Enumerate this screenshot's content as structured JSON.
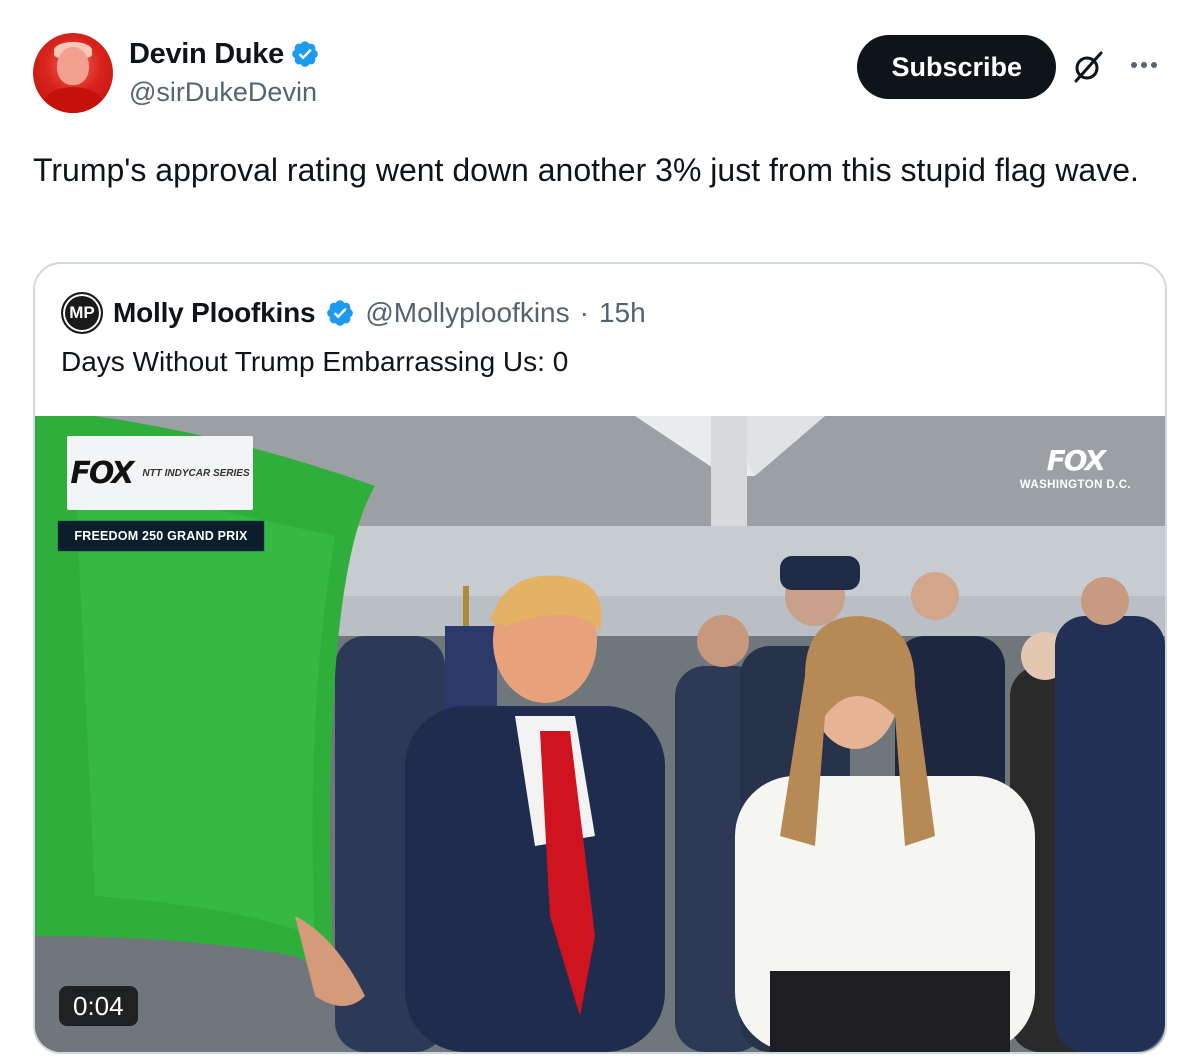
{
  "author": {
    "display_name": "Devin Duke",
    "handle": "@sirDukeDevin",
    "verified_icon": "verified-badge-icon"
  },
  "actions": {
    "subscribe_label": "Subscribe",
    "grok_icon": "grok-icon",
    "more_icon": "more-icon"
  },
  "tweet": {
    "text": "Trump's approval rating went down another 3% just from this stupid flag wave."
  },
  "quoted": {
    "avatar_text": "MP",
    "display_name": "Molly Ploofkins",
    "handle": "@Mollyploofkins",
    "separator": "·",
    "time": "15h",
    "text": "Days Without Trump Embarrassing Us: 0",
    "video": {
      "duration": "0:04",
      "overlay_left_brand": "FOX",
      "overlay_left_series": "NTT INDYCAR SERIES",
      "overlay_event": "FREEDOM 250 GRAND PRIX",
      "overlay_right_brand": "FOX",
      "overlay_right_location": "WASHINGTON D.C."
    }
  },
  "colors": {
    "verified": "#1d9bf0",
    "button_bg": "#0f1419",
    "secondary_text": "#536471",
    "border": "#cfd9de",
    "flag_green": "#2fae3c"
  }
}
